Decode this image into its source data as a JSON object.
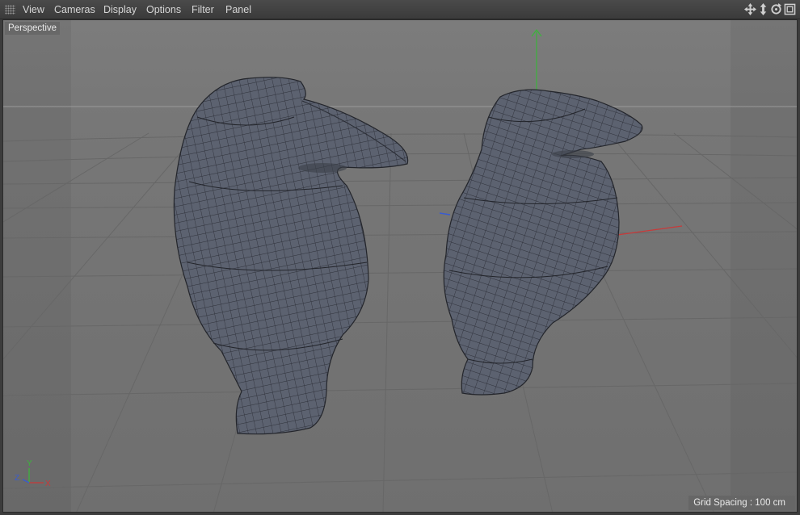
{
  "menubar": {
    "items": [
      {
        "label": "View"
      },
      {
        "label": "Cameras"
      },
      {
        "label": "Display"
      },
      {
        "label": "Options"
      },
      {
        "label": "Filter"
      },
      {
        "label": "Panel"
      }
    ],
    "toolbar_icons": [
      "move-view-icon",
      "dolly-view-icon",
      "rotate-view-icon",
      "toggle-layout-icon"
    ]
  },
  "viewport": {
    "camera_label": "Perspective",
    "grid_spacing": "Grid Spacing : 100 cm",
    "axis_labels": {
      "x": "X",
      "y": "Y",
      "z": "Z"
    }
  },
  "colors": {
    "background": "#7a7a7a",
    "grid_line": "#6a6a6a",
    "mesh_fill": "#5b6170",
    "mesh_wire": "#2a2c33",
    "axis_x": "#c83a3a",
    "axis_y": "#3cb33c",
    "axis_z": "#3a5cd0"
  }
}
